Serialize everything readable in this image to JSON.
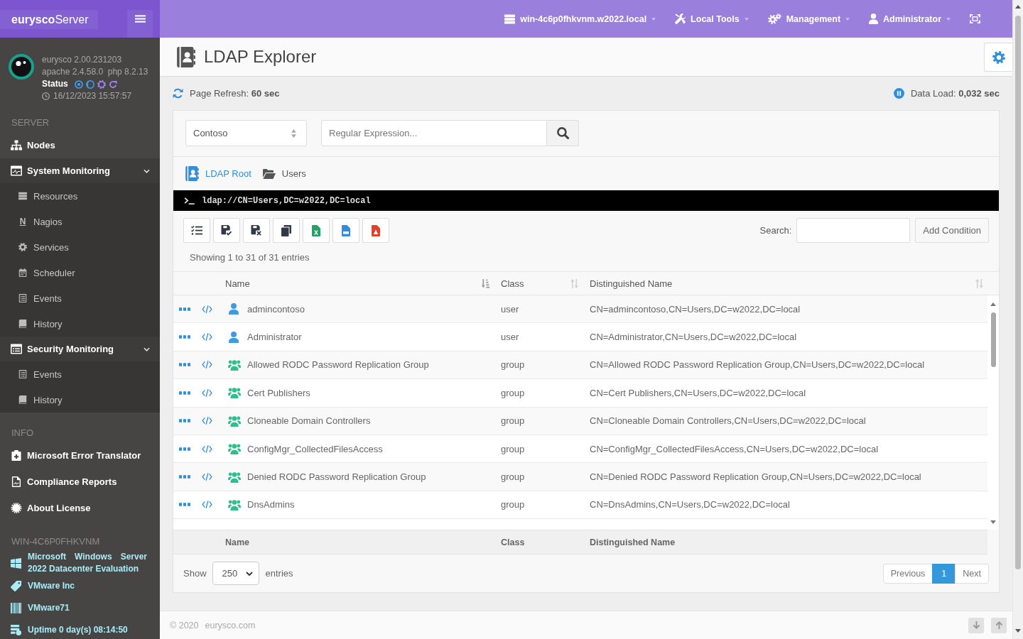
{
  "topbar": {
    "brand": "**eurysco**Server",
    "menus": [
      {
        "label": "win-4c6p0fhkvnm.w2022.local"
      },
      {
        "label": "Local Tools"
      },
      {
        "label": "Management"
      },
      {
        "label": "Administrator"
      }
    ]
  },
  "sidebar": {
    "about": {
      "version": "eurysco 2.00.231203",
      "stack": "apache 2.4.58.0  php 8.2.13",
      "status_label": "Status",
      "timestamp": "16/12/2023 15:57:57"
    },
    "sections": [
      {
        "heading": "SERVER",
        "kind": "menu",
        "items": [
          {
            "label": "Nodes"
          },
          {
            "label": "System Monitoring",
            "expanded": true,
            "children": [
              {
                "label": "Resources"
              },
              {
                "label": "Nagios",
                "glyph": "N"
              },
              {
                "label": "Services"
              },
              {
                "label": "Scheduler"
              },
              {
                "label": "Events"
              },
              {
                "label": "History"
              }
            ]
          },
          {
            "label": "Security Monitoring",
            "expanded": true,
            "children": [
              {
                "label": "Events"
              },
              {
                "label": "History"
              }
            ]
          }
        ]
      },
      {
        "heading": "INFO",
        "kind": "menu",
        "items": [
          {
            "label": "Microsoft Error Translator"
          },
          {
            "label": "Compliance Reports"
          },
          {
            "label": "About License"
          }
        ]
      },
      {
        "heading": "WIN-4C6P0FHKVNM",
        "kind": "facts",
        "items": [
          {
            "label": "Microsoft Windows Server 2022 Datacenter Evaluation"
          },
          {
            "label": "VMware Inc"
          },
          {
            "label": "VMware71"
          },
          {
            "label": "Uptime 0 day(s) 08:14:50"
          }
        ]
      }
    ]
  },
  "page": {
    "title": "LDAP Explorer",
    "page_refresh": "Page Refresh: **60 sec**",
    "data_load": "Data Load: **0,032 sec**"
  },
  "explorer": {
    "domain_select": {
      "value": "Contoso"
    },
    "filter": {
      "placeholder": "Regular Expression..."
    },
    "breadcrumb": [
      {
        "label": "LDAP Root",
        "kind": "root"
      },
      {
        "label": "Users",
        "kind": "folder"
      }
    ],
    "path": "ldap://CN=Users,DC=w2022,DC=local",
    "search": {
      "label": "Search:"
    },
    "add_condition": "Add Condition",
    "info": "Showing 1 to 31 of 31 entries"
  },
  "table": {
    "columns": [
      {
        "label": "Name",
        "sorted": true
      },
      {
        "label": "Class",
        "sorted": false
      },
      {
        "label": "Distinguished Name",
        "sorted": false
      }
    ],
    "rows": [
      {
        "kind": "user",
        "name": "admincontoso",
        "class": "user",
        "dn": "CN=admincontoso,CN=Users,DC=w2022,DC=local"
      },
      {
        "kind": "user",
        "name": "Administrator",
        "class": "user",
        "dn": "CN=Administrator,CN=Users,DC=w2022,DC=local"
      },
      {
        "kind": "group",
        "name": "Allowed RODC Password Replication Group",
        "class": "group",
        "dn": "CN=Allowed RODC Password Replication Group,CN=Users,DC=w2022,DC=local"
      },
      {
        "kind": "group",
        "name": "Cert Publishers",
        "class": "group",
        "dn": "CN=Cert Publishers,CN=Users,DC=w2022,DC=local"
      },
      {
        "kind": "group",
        "name": "Cloneable Domain Controllers",
        "class": "group",
        "dn": "CN=Cloneable Domain Controllers,CN=Users,DC=w2022,DC=local"
      },
      {
        "kind": "group",
        "name": "ConfigMgr_CollectedFilesAccess",
        "class": "group",
        "dn": "CN=ConfigMgr_CollectedFilesAccess,CN=Users,DC=w2022,DC=local"
      },
      {
        "kind": "group",
        "name": "Denied RODC Password Replication Group",
        "class": "group",
        "dn": "CN=Denied RODC Password Replication Group,CN=Users,DC=w2022,DC=local"
      },
      {
        "kind": "group",
        "name": "DnsAdmins",
        "class": "group",
        "dn": "CN=DnsAdmins,CN=Users,DC=w2022,DC=local"
      }
    ],
    "footer_columns": [
      "Name",
      "Class",
      "Distinguished Name"
    ]
  },
  "pager": {
    "show": "Show",
    "length": "250",
    "entries": "entries",
    "previous": "Previous",
    "pages": [
      {
        "label": "1",
        "selected": true
      }
    ],
    "next": "Next"
  },
  "footer": {
    "copyright": "© 2020",
    "site": "eurysco.com"
  }
}
